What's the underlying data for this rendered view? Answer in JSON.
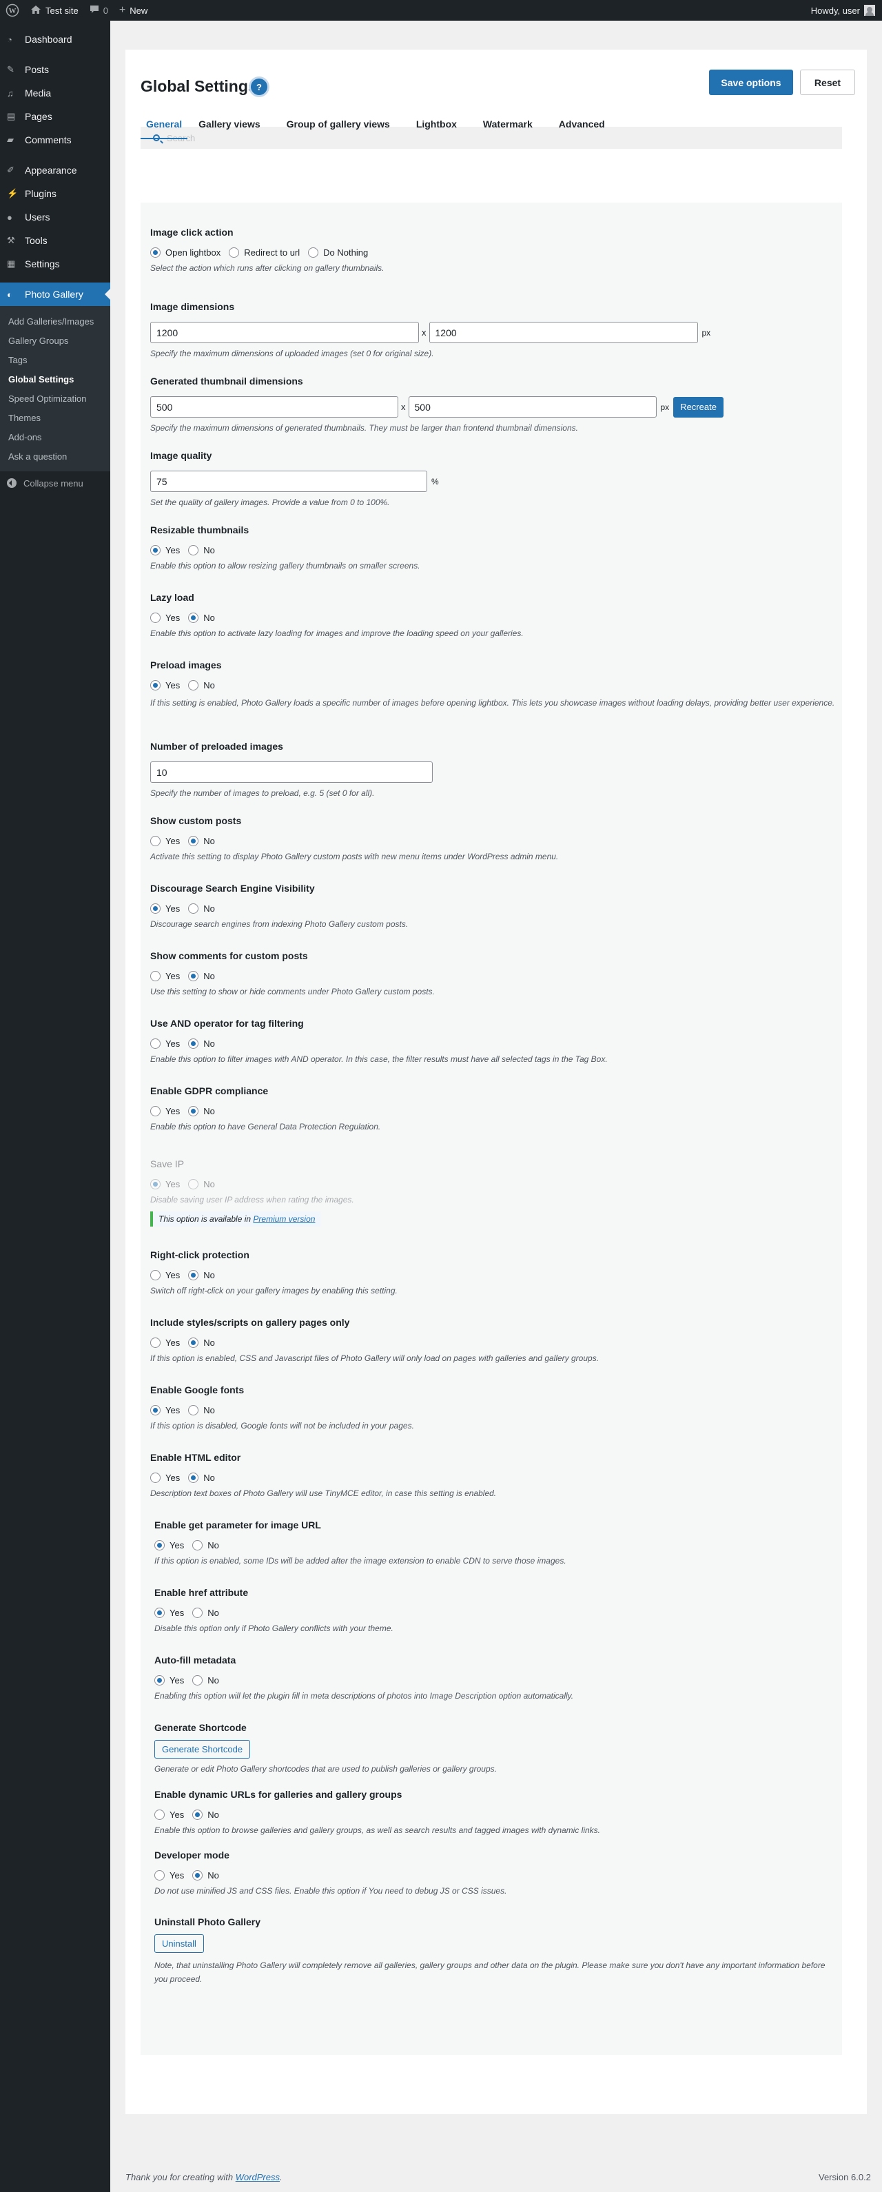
{
  "adminbar": {
    "site": "Test site",
    "comments_count": "0",
    "new": "New",
    "howdy": "Howdy, user"
  },
  "sidebar": {
    "items": [
      {
        "label": "Dashboard",
        "icon": "dashboard-icon"
      },
      {
        "label": "Posts",
        "icon": "pin-icon"
      },
      {
        "label": "Media",
        "icon": "media-icon"
      },
      {
        "label": "Pages",
        "icon": "page-icon"
      },
      {
        "label": "Comments",
        "icon": "comment-icon"
      },
      {
        "label": "Appearance",
        "icon": "brush-icon"
      },
      {
        "label": "Plugins",
        "icon": "plug-icon"
      },
      {
        "label": "Users",
        "icon": "user-icon"
      },
      {
        "label": "Tools",
        "icon": "wrench-icon"
      },
      {
        "label": "Settings",
        "icon": "settings-icon"
      },
      {
        "label": "Photo Gallery",
        "icon": "photo-gallery-icon"
      }
    ],
    "submenu": [
      "Add Galleries/Images",
      "Gallery Groups",
      "Tags",
      "Global Settings",
      "Speed Optimization",
      "Themes",
      "Add-ons",
      "Ask a question"
    ],
    "collapse": "Collapse menu"
  },
  "page": {
    "title": "Global Settings",
    "help": "?",
    "save": "Save options",
    "reset": "Reset",
    "search_placeholder": "Search"
  },
  "tabs": [
    "General",
    "Gallery views",
    "Group of gallery views",
    "Lightbox",
    "Watermark",
    "Advanced"
  ],
  "options": {
    "click_action": {
      "title": "Image click action",
      "choices": [
        "Open lightbox",
        "Redirect to url",
        "Do Nothing"
      ],
      "selected": "Open lightbox",
      "desc": "Select the action which runs after clicking on gallery thumbnails."
    },
    "dimensions": {
      "title": "Image dimensions",
      "width": "1200",
      "height": "1200",
      "x": "x",
      "unit": "px",
      "desc": "Specify the maximum dimensions of uploaded images (set 0 for original size)."
    },
    "thumb_dimensions": {
      "title": "Generated thumbnail dimensions",
      "width": "500",
      "height": "500",
      "x": "x",
      "unit": "px",
      "button": "Recreate",
      "desc": "Specify the maximum dimensions of generated thumbnails. They must be larger than frontend thumbnail dimensions."
    },
    "quality": {
      "title": "Image quality",
      "value": "75",
      "unit": "%",
      "desc": "Set the quality of gallery images. Provide a value from 0 to 100%."
    },
    "resizable": {
      "title": "Resizable thumbnails",
      "selected": "Yes",
      "desc": "Enable this option to allow resizing gallery thumbnails on smaller screens."
    },
    "lazy_load": {
      "title": "Lazy load",
      "selected": "No",
      "desc": "Enable this option to activate lazy loading for images and improve the loading speed on your galleries."
    },
    "preload": {
      "title": "Preload images",
      "selected": "Yes",
      "desc": "If this setting is enabled, Photo Gallery loads a specific number of images before opening lightbox. This lets you showcase images without loading delays, providing better user experience."
    },
    "preload_count": {
      "title": "Number of preloaded images",
      "value": "10",
      "desc": "Specify the number of images to preload, e.g. 5 (set 0 for all)."
    },
    "custom_posts": {
      "title": "Show custom posts",
      "selected": "No",
      "desc": "Activate this setting to display Photo Gallery custom posts with new menu items under WordPress admin menu."
    },
    "discourage_se": {
      "title": "Discourage Search Engine Visibility",
      "selected": "Yes",
      "desc": "Discourage search engines from indexing Photo Gallery custom posts."
    },
    "comments_custom": {
      "title": "Show comments for custom posts",
      "selected": "No",
      "desc": "Use this setting to show or hide comments under Photo Gallery custom posts."
    },
    "and_operator": {
      "title": "Use AND operator for tag filtering",
      "selected": "No",
      "desc": "Enable this option to filter images with AND operator. In this case, the filter results must have all selected tags in the Tag Box."
    },
    "gdpr": {
      "title": "Enable GDPR compliance",
      "selected": "No",
      "desc": "Enable this option to have General Data Protection Regulation."
    },
    "save_ip": {
      "title": "Save IP",
      "selected": "Yes",
      "desc": "Disable saving user IP address when rating the images.",
      "notice": "This option is available in",
      "notice_link": "Premium version"
    },
    "right_click": {
      "title": "Right-click protection",
      "selected": "No",
      "desc": "Switch off right-click on your gallery images by enabling this setting."
    },
    "styles_only": {
      "title": "Include styles/scripts on gallery pages only",
      "selected": "No",
      "desc": "If this option is enabled, CSS and Javascript files of Photo Gallery will only load on pages with galleries and gallery groups."
    },
    "google_fonts": {
      "title": "Enable Google fonts",
      "selected": "Yes",
      "desc": "If this option is disabled, Google fonts will not be included in your pages."
    },
    "html_editor": {
      "title": "Enable HTML editor",
      "selected": "No",
      "desc": "Description text boxes of Photo Gallery will use TinyMCE editor, in case this setting is enabled."
    },
    "get_param": {
      "title": "Enable get parameter for image URL",
      "selected": "Yes",
      "desc": "If this option is enabled, some IDs will be added after the image extension to enable CDN to serve those images."
    },
    "href_attr": {
      "title": "Enable href attribute",
      "selected": "Yes",
      "desc": "Disable this option only if Photo Gallery conflicts with your theme."
    },
    "autofill": {
      "title": "Auto-fill metadata",
      "selected": "Yes",
      "desc": "Enabling this option will let the plugin fill in meta descriptions of photos into Image Description option automatically."
    },
    "shortcode": {
      "title": "Generate Shortcode",
      "button": "Generate Shortcode",
      "desc": "Generate or edit Photo Gallery shortcodes that are used to publish galleries or gallery groups."
    },
    "dynamic_urls": {
      "title": "Enable dynamic URLs for galleries and gallery groups",
      "selected": "No",
      "desc": "Enable this option to browse galleries and gallery groups, as well as search results and tagged images with dynamic links."
    },
    "developer": {
      "title": "Developer mode",
      "selected": "No",
      "desc": "Do not use minified JS and CSS files. Enable this option if You need to debug JS or CSS issues."
    },
    "uninstall": {
      "title": "Uninstall Photo Gallery",
      "button": "Uninstall",
      "desc": "Note, that uninstalling Photo Gallery will completely remove all galleries, gallery groups and other data on the plugin. Please make sure you don't have any important information before you proceed."
    }
  },
  "yes_label": "Yes",
  "no_label": "No",
  "footer": {
    "text": "Thank you for creating with",
    "link": "WordPress",
    "version": "Version 6.0.2"
  },
  "colors": {
    "accent": "#2271b1",
    "sidebar": "#1d2327"
  }
}
